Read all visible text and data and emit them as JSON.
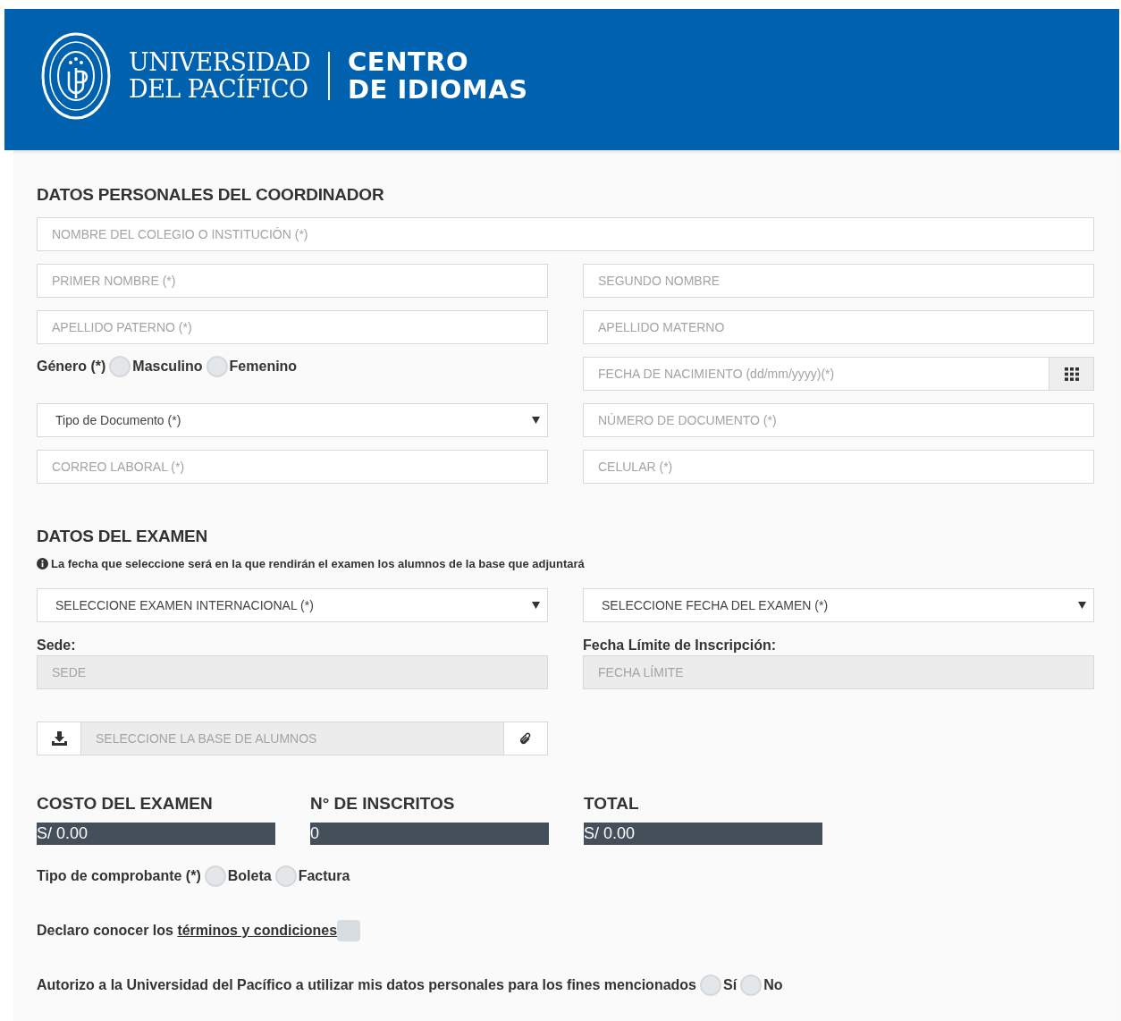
{
  "header": {
    "university_lines": [
      "UNIVERSIDAD",
      "DEL PACÍFICO"
    ],
    "center_lines": [
      "CENTRO",
      "DE IDIOMAS"
    ]
  },
  "personal": {
    "title": "DATOS PERSONALES DEL COORDINADOR",
    "rows": [
      [
        {
          "kind": "text",
          "placeholder": "NOMBRE DEL COLEGIO O INSTITUCIÓN (*)"
        }
      ],
      [
        {
          "kind": "text",
          "placeholder": "PRIMER NOMBRE (*)"
        },
        {
          "kind": "text",
          "placeholder": "SEGUNDO NOMBRE"
        }
      ],
      [
        {
          "kind": "text",
          "placeholder": "APELLIDO PATERNO (*)"
        },
        {
          "kind": "text",
          "placeholder": "APELLIDO MATERNO"
        }
      ],
      [
        {
          "kind": "radio",
          "label": "Género (*)",
          "options": [
            {
              "label": "Masculino",
              "selected": false
            },
            {
              "label": "Femenino",
              "selected": false
            }
          ]
        },
        {
          "kind": "date",
          "placeholder": "FECHA DE NACIMIENTO (dd/mm/yyyy)(*)"
        }
      ],
      [
        {
          "kind": "select",
          "value": "Tipo de Documento (*)"
        },
        {
          "kind": "text",
          "placeholder": "NÚMERO DE DOCUMENTO (*)"
        }
      ],
      [
        {
          "kind": "text",
          "placeholder": "CORREO LABORAL (*)"
        },
        {
          "kind": "text",
          "placeholder": "CELULAR (*)"
        }
      ]
    ]
  },
  "exam": {
    "title": "DATOS DEL EXAMEN",
    "note": "La fecha que seleccione será en la que rendirán el examen los alumnos de la base que adjuntará",
    "rows": [
      [
        {
          "kind": "select",
          "value": "SELECCIONE EXAMEN INTERNACIONAL (*)"
        },
        {
          "kind": "select",
          "value": "SELECCIONE FECHA DEL EXAMEN (*)"
        }
      ],
      [
        {
          "kind": "readonly",
          "label": "Sede:",
          "placeholder": "SEDE"
        },
        {
          "kind": "readonly",
          "label": "Fecha Límite de Inscripción:",
          "placeholder": "FECHA LÍMITE"
        }
      ],
      [
        {
          "kind": "file",
          "placeholder": "SELECCIONE LA BASE DE ALUMNOS"
        }
      ]
    ]
  },
  "summary": [
    {
      "label": "COSTO DEL EXAMEN",
      "value": "S/ 0.00"
    },
    {
      "label": "N° DE INSCRITOS",
      "value": "0"
    },
    {
      "label": "TOTAL",
      "value": "S/ 0.00"
    }
  ],
  "voucher": {
    "label": "Tipo de comprobante (*)",
    "options": [
      {
        "label": "Boleta",
        "selected": false
      },
      {
        "label": "Factura",
        "selected": false
      }
    ]
  },
  "terms": {
    "text": "Declaro conocer los",
    "link": "términos y condiciones",
    "checked": false
  },
  "consent": {
    "label": "Autorizo a la Universidad del Pacífico a utilizar mis datos personales para los fines mencionados",
    "options": [
      {
        "label": "Sí",
        "selected": false
      },
      {
        "label": "No",
        "selected": false
      }
    ]
  }
}
